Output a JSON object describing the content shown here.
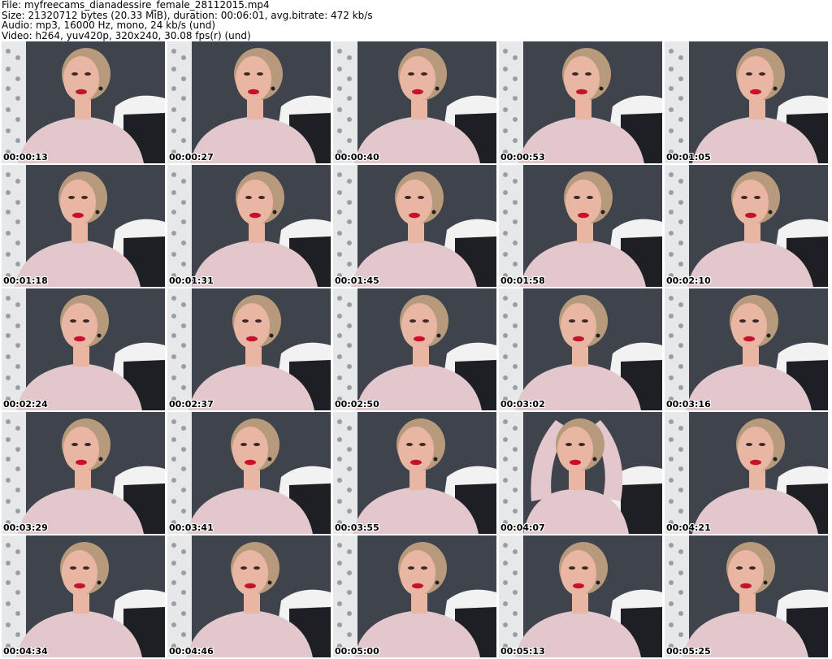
{
  "header": {
    "file_line": "File: myfreecams_dianadessire_female_28112015.mp4",
    "size_line": "Size: 21320712 bytes (20.33 MiB), duration: 00:06:01, avg.bitrate: 472 kb/s",
    "audio_line": "Audio: mp3, 16000 Hz, mono, 24 kb/s (und)",
    "video_line": "Video: h264, yuv420p, 320x240, 30.08 fps(r) (und)"
  },
  "thumbnails": [
    {
      "timestamp": "00:00:13"
    },
    {
      "timestamp": "00:00:27"
    },
    {
      "timestamp": "00:00:40"
    },
    {
      "timestamp": "00:00:53"
    },
    {
      "timestamp": "00:01:05"
    },
    {
      "timestamp": "00:01:18"
    },
    {
      "timestamp": "00:01:31"
    },
    {
      "timestamp": "00:01:45"
    },
    {
      "timestamp": "00:01:58"
    },
    {
      "timestamp": "00:02:10"
    },
    {
      "timestamp": "00:02:24"
    },
    {
      "timestamp": "00:02:37"
    },
    {
      "timestamp": "00:02:50"
    },
    {
      "timestamp": "00:03:02"
    },
    {
      "timestamp": "00:03:16"
    },
    {
      "timestamp": "00:03:29"
    },
    {
      "timestamp": "00:03:41"
    },
    {
      "timestamp": "00:03:55"
    },
    {
      "timestamp": "00:04:07"
    },
    {
      "timestamp": "00:04:21"
    },
    {
      "timestamp": "00:04:34"
    },
    {
      "timestamp": "00:04:46"
    },
    {
      "timestamp": "00:05:00"
    },
    {
      "timestamp": "00:05:13"
    },
    {
      "timestamp": "00:05:25"
    }
  ],
  "colors": {
    "wall": "#3f444c",
    "screen": "#e6e8ea",
    "sweater": "#e2c8cc",
    "skin": "#e8b6a2",
    "hair": "#b79a7c",
    "lips": "#c8102e",
    "bedding": "#f2f2f2"
  }
}
